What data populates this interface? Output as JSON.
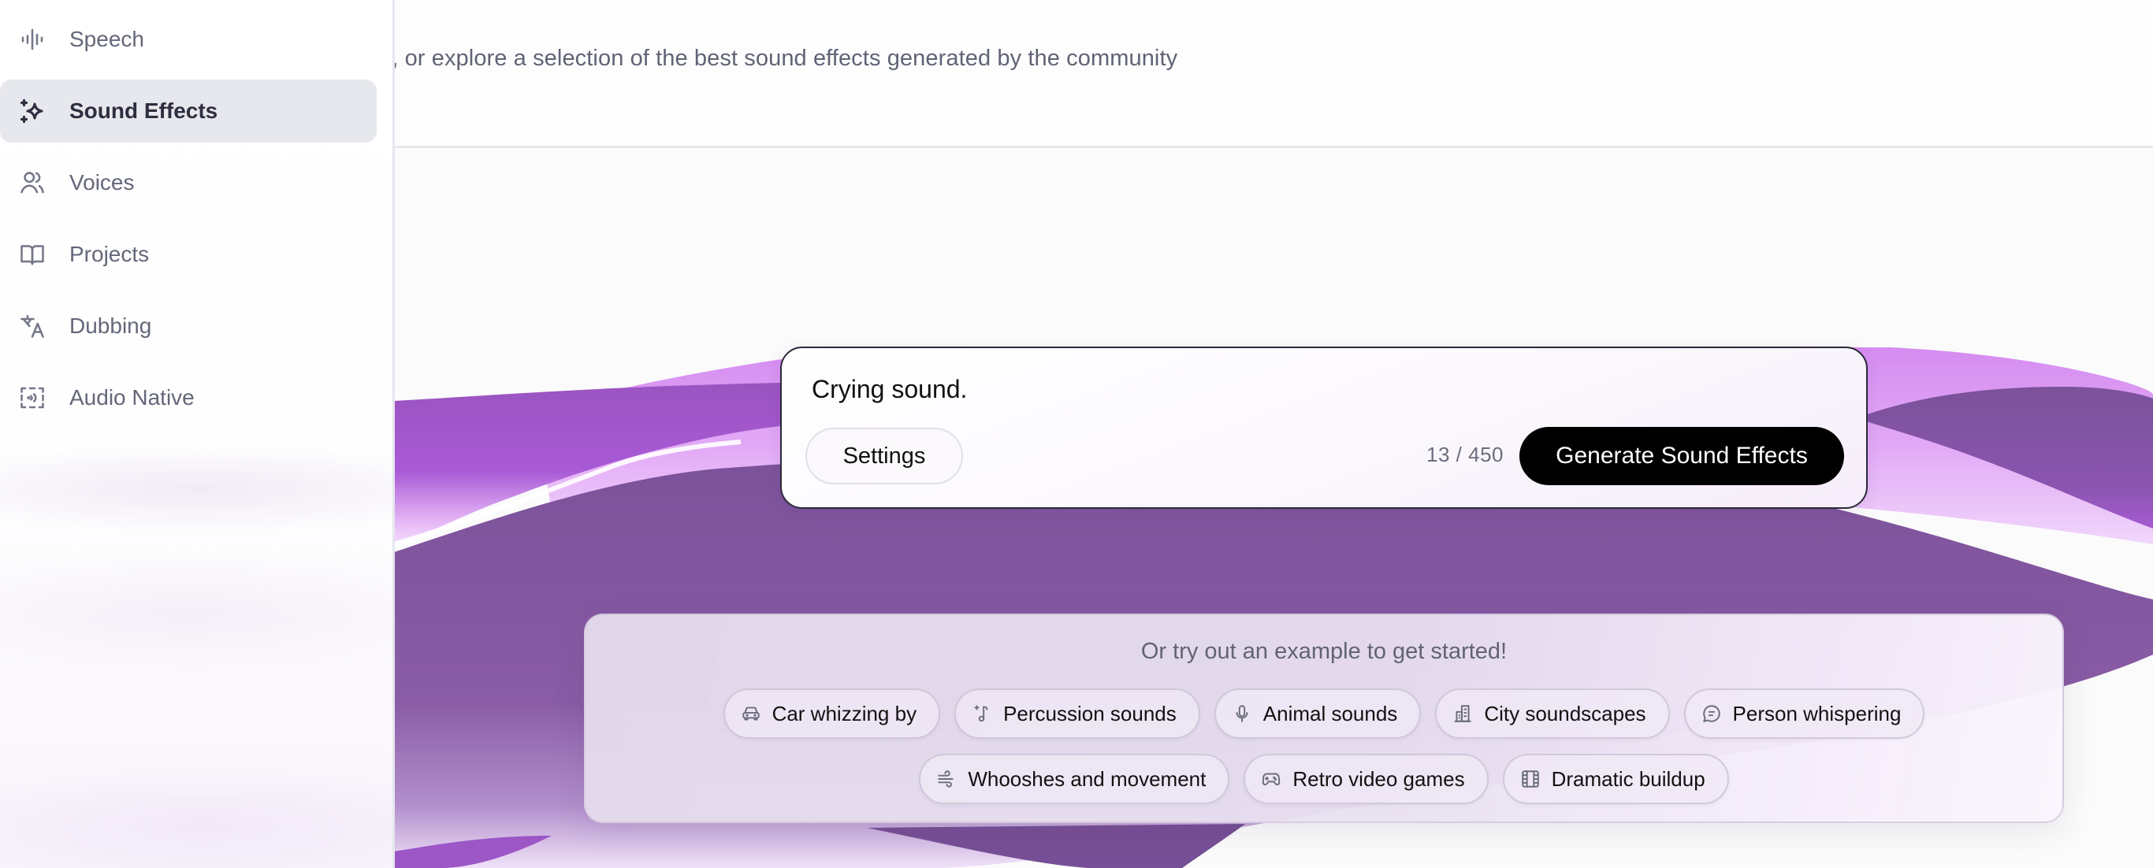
{
  "header": {
    "description": "g it to life, or explore a selection of the best sound effects generated by the community"
  },
  "sidebar": {
    "items": [
      {
        "label": "Speech",
        "icon": "waveform-icon",
        "active": false
      },
      {
        "label": "Sound Effects",
        "icon": "sparkles-icon",
        "active": true
      },
      {
        "label": "Voices",
        "icon": "users-icon",
        "active": false
      },
      {
        "label": "Projects",
        "icon": "book-open-icon",
        "active": false
      },
      {
        "label": "Dubbing",
        "icon": "translate-icon",
        "active": false
      },
      {
        "label": "Audio Native",
        "icon": "broadcast-frame-icon",
        "active": false
      }
    ]
  },
  "prompt": {
    "value": "Crying sound.",
    "settings_label": "Settings",
    "char_count": "13 / 450",
    "char_used": 13,
    "char_limit": 450,
    "generate_label": "Generate Sound Effects"
  },
  "examples": {
    "title": "Or try out an example to get started!",
    "rows": [
      [
        {
          "label": "Car whizzing by",
          "icon": "car-icon"
        },
        {
          "label": "Percussion sounds",
          "icon": "music-note-plus-icon"
        },
        {
          "label": "Animal sounds",
          "icon": "microphone-icon"
        },
        {
          "label": "City soundscapes",
          "icon": "building-icon"
        },
        {
          "label": "Person whispering",
          "icon": "chat-bubble-icon"
        }
      ],
      [
        {
          "label": "Whooshes and movement",
          "icon": "wind-icon"
        },
        {
          "label": "Retro video games",
          "icon": "gamepad-icon"
        },
        {
          "label": "Dramatic buildup",
          "icon": "film-reel-icon"
        }
      ]
    ]
  },
  "colors": {
    "accent_dark": "#7b5299",
    "accent_mid": "#a55bd2",
    "accent_light": "#dd9bf3",
    "button_primary": "#000000",
    "nav_active_bg": "#e7e8ed"
  }
}
